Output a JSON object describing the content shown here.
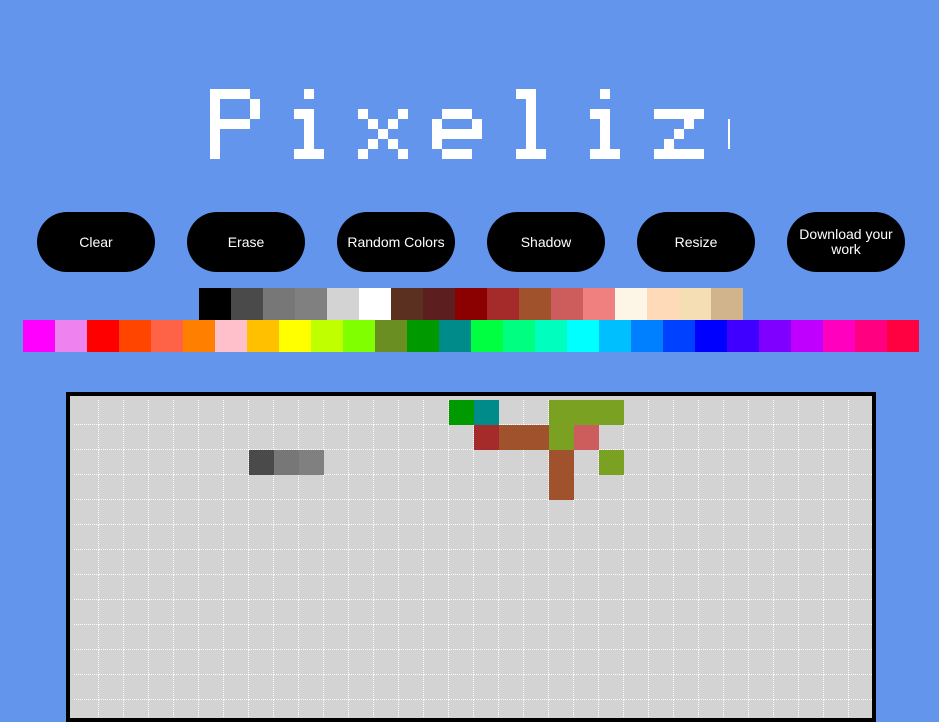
{
  "app": {
    "title": "Pixelize"
  },
  "controls": [
    {
      "name": "clear-button",
      "label": "Clear"
    },
    {
      "name": "erase-button",
      "label": "Erase"
    },
    {
      "name": "random-colors-button",
      "label": "Random Colors"
    },
    {
      "name": "shadow-button",
      "label": "Shadow"
    },
    {
      "name": "resize-button",
      "label": "Resize"
    },
    {
      "name": "download-button",
      "label": "Download your work"
    }
  ],
  "palette": {
    "row1": [
      "#000000",
      "#4a4a4a",
      "#777777",
      "#808080",
      "#d3d3d3",
      "#ffffff",
      "#5c3020",
      "#5c1e1e",
      "#8b0000",
      "#a52a2a",
      "#a0522d",
      "#cd5c5c",
      "#f08080",
      "#fdf5e6",
      "#ffdab9",
      "#f5deb3",
      "#d2b48c"
    ],
    "row2": [
      "#ff00ff",
      "#ee82ee",
      "#ff0000",
      "#ff4500",
      "#ff6347",
      "#ff8000",
      "#ffc0cb",
      "#ffc000",
      "#ffff00",
      "#bfff00",
      "#80ff00",
      "#6b8e23",
      "#009900",
      "#008b8b",
      "#00ff40",
      "#00ff80",
      "#00ffbf",
      "#00ffff",
      "#00bfff",
      "#0080ff",
      "#0040ff",
      "#0000ff",
      "#4000ff",
      "#8000ff",
      "#bf00ff",
      "#ff00bf",
      "#ff0080",
      "#ff0040"
    ]
  },
  "canvas": {
    "background": "#d3d3d3",
    "grid_color": "#ffffff",
    "columns": 32,
    "rows": 13,
    "painted": [
      {
        "col": 15,
        "row": 0,
        "color": "#009900"
      },
      {
        "col": 16,
        "row": 0,
        "color": "#008b8b"
      },
      {
        "col": 19,
        "row": 0,
        "color": "#7ba123"
      },
      {
        "col": 20,
        "row": 0,
        "color": "#7ba123"
      },
      {
        "col": 21,
        "row": 0,
        "color": "#7ba123"
      },
      {
        "col": 16,
        "row": 1,
        "color": "#a52a2a"
      },
      {
        "col": 17,
        "row": 1,
        "color": "#a0522d"
      },
      {
        "col": 18,
        "row": 1,
        "color": "#a0522d"
      },
      {
        "col": 19,
        "row": 1,
        "color": "#7ba123"
      },
      {
        "col": 20,
        "row": 1,
        "color": "#cd5c5c"
      },
      {
        "col": 7,
        "row": 2,
        "color": "#4a4a4a"
      },
      {
        "col": 8,
        "row": 2,
        "color": "#777777"
      },
      {
        "col": 9,
        "row": 2,
        "color": "#808080"
      },
      {
        "col": 19,
        "row": 2,
        "color": "#a0522d"
      },
      {
        "col": 21,
        "row": 2,
        "color": "#7ba123"
      },
      {
        "col": 19,
        "row": 3,
        "color": "#a0522d"
      }
    ]
  }
}
